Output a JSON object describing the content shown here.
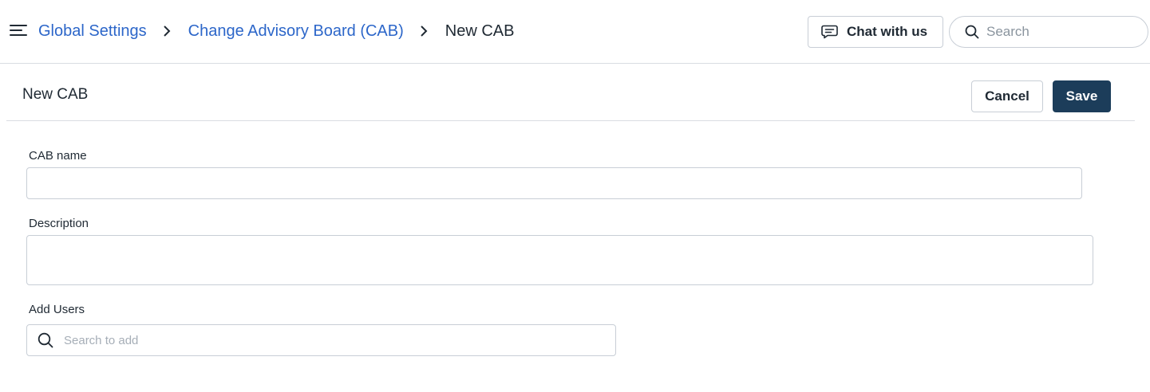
{
  "header": {
    "menu_icon": "hamburger-menu-icon",
    "breadcrumb": {
      "items": [
        {
          "label": "Global Settings"
        },
        {
          "label": "Change Advisory Board (CAB)"
        }
      ],
      "current": "New CAB",
      "separator_icon": "chevron-right-icon"
    },
    "chat_button": {
      "label": "Chat with us",
      "icon": "chat-bubble-icon"
    },
    "search": {
      "placeholder": "Search",
      "value": "",
      "icon": "search-icon"
    }
  },
  "subheader": {
    "title": "New CAB",
    "cancel_label": "Cancel",
    "save_label": "Save"
  },
  "form": {
    "cab_name": {
      "label": "CAB name",
      "value": ""
    },
    "description": {
      "label": "Description",
      "value": ""
    },
    "add_users": {
      "label": "Add Users",
      "placeholder": "Search to add",
      "value": "",
      "icon": "search-icon"
    }
  },
  "colors": {
    "link": "#2c66c9",
    "primary_button": "#1c3d5a",
    "border": "#c8ced6",
    "divider": "#d9dde2",
    "text": "#1f2933"
  }
}
